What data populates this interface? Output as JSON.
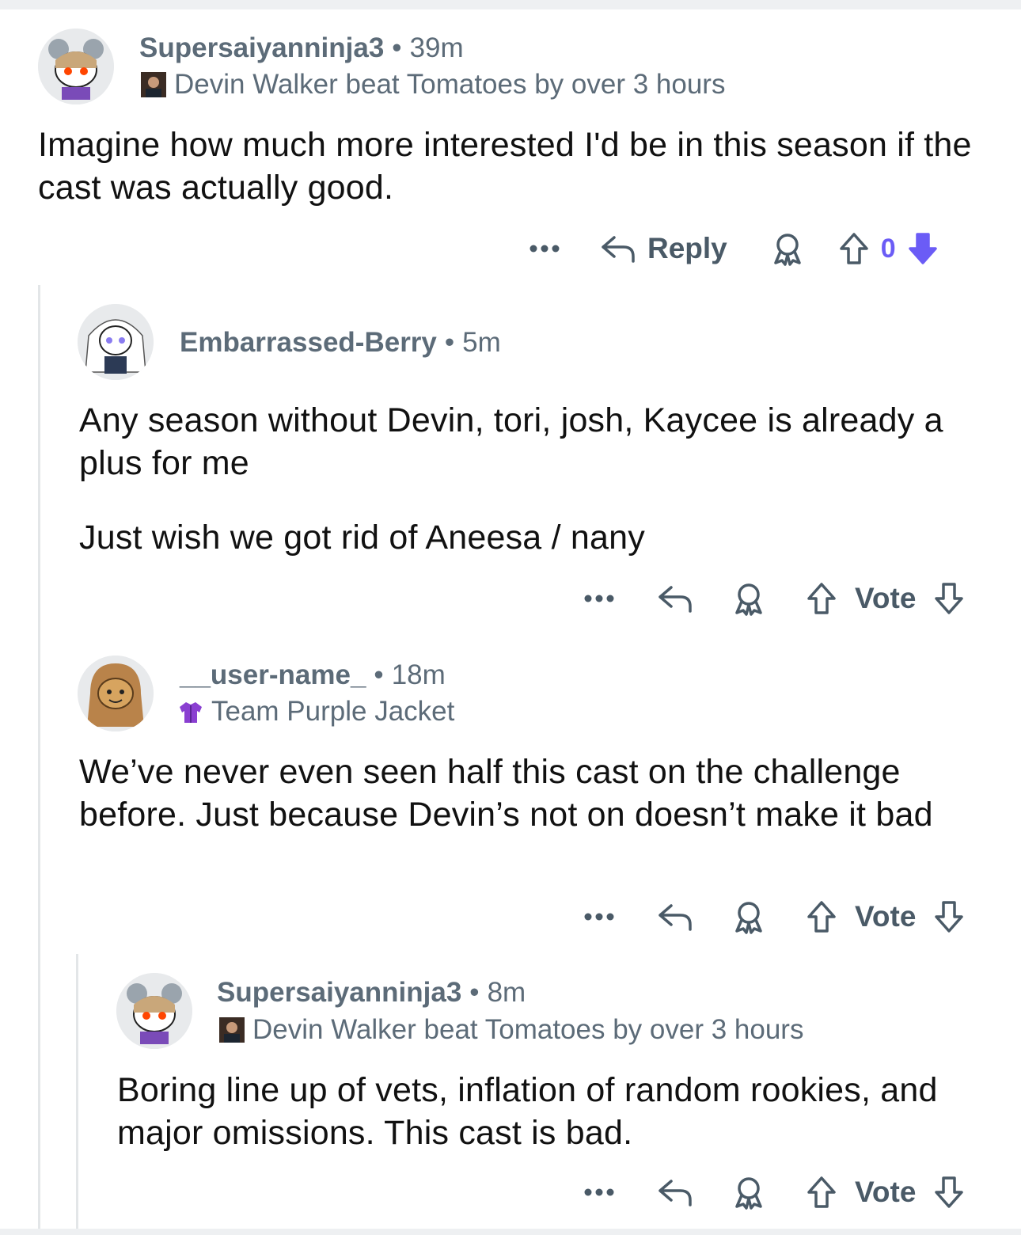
{
  "colors": {
    "accent": "#6b5cf6",
    "meta": "#5c6b78",
    "thread": "#e3e6e8"
  },
  "comments": [
    {
      "username": "Supersaiyanninja3",
      "time": "39m",
      "flair": "Devin Walker beat Tomatoes by over 3 hours",
      "paragraphs": [
        "Imagine how much more interested I'd be in this season if the cast was actually good."
      ],
      "actions": {
        "more": "•••",
        "reply_label": "Reply",
        "vote_count": "0"
      }
    },
    {
      "username": "Embarrassed-Berry",
      "time": "5m",
      "paragraphs": [
        "Any season without Devin, tori, josh, Kaycee is already a plus for me",
        "Just wish we got rid of Aneesa / nany"
      ],
      "actions": {
        "more": "•••",
        "vote_label": "Vote"
      }
    },
    {
      "username": "__user-name_",
      "time": "18m",
      "flair": "Team Purple Jacket",
      "paragraphs": [
        "We’ve never even seen half this cast on the challenge before. Just because Devin’s not on doesn’t make it bad"
      ],
      "actions": {
        "more": "•••",
        "vote_label": "Vote"
      }
    },
    {
      "username": "Supersaiyanninja3",
      "time": "8m",
      "flair": "Devin Walker beat Tomatoes by over 3 hours",
      "paragraphs": [
        "Boring line up of vets, inflation of random rookies, and major omissions. This cast is bad."
      ],
      "actions": {
        "more": "•••",
        "vote_label": "Vote"
      }
    }
  ],
  "separator": "•",
  "icons": [
    "reply-arrow-icon",
    "award-icon",
    "upvote-icon",
    "downvote-icon",
    "more-icon"
  ]
}
